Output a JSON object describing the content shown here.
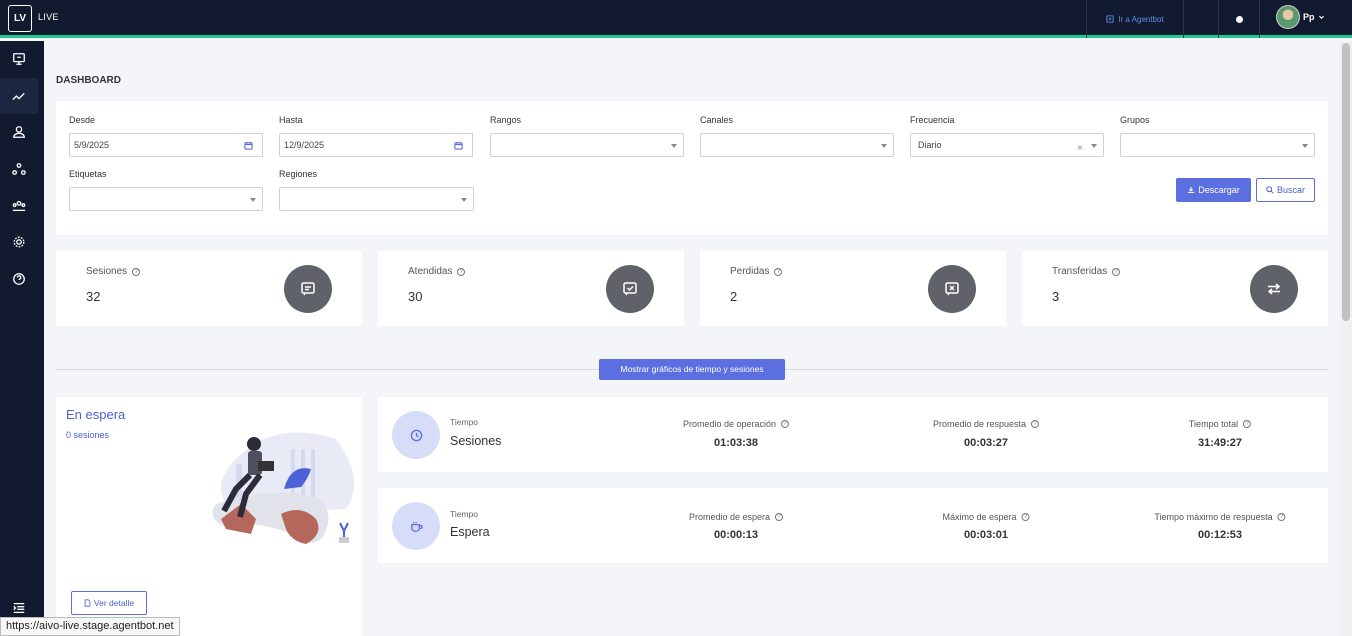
{
  "header": {
    "logo": "LV",
    "app_name": "LIVE",
    "agentbot_link": "Ir a Agentbot",
    "user_initials": "Pp"
  },
  "sidebar": {
    "items": [
      {
        "icon": "monitor-icon"
      },
      {
        "icon": "chart-line-icon",
        "active": true
      },
      {
        "icon": "user-icon"
      },
      {
        "icon": "network-icon"
      },
      {
        "icon": "team-icon"
      },
      {
        "icon": "gear-icon"
      },
      {
        "icon": "help-icon"
      }
    ]
  },
  "page": {
    "title": "DASHBOARD"
  },
  "filters": {
    "desde_label": "Desde",
    "desde_value": "5/9/2025",
    "hasta_label": "Hasta",
    "hasta_value": "12/9/2025",
    "rangos_label": "Rangos",
    "rangos_value": "",
    "canales_label": "Canales",
    "canales_value": "",
    "frecuencia_label": "Frecuencia",
    "frecuencia_value": "Diario",
    "grupos_label": "Grupos",
    "grupos_value": "",
    "etiquetas_label": "Etiquetas",
    "etiquetas_value": "",
    "regiones_label": "Regiones",
    "regiones_value": "",
    "download_label": "Descargar",
    "search_label": "Buscar"
  },
  "stats": [
    {
      "label": "Sesiones",
      "value": "32"
    },
    {
      "label": "Atendidas",
      "value": "30"
    },
    {
      "label": "Perdidas",
      "value": "2"
    },
    {
      "label": "Transferidas",
      "value": "3"
    }
  ],
  "toggle_charts": "Mostrar gráficos de tiempo y sesiones",
  "waiting": {
    "title": "En espera",
    "subtitle": "0 sesiones",
    "detail_button": "Ver detalle"
  },
  "metrics": {
    "sessions": {
      "small": "Tiempo",
      "big": "Sesiones",
      "cols": [
        {
          "label": "Promedio de operación",
          "value": "01:03:38"
        },
        {
          "label": "Promedio de respuesta",
          "value": "00:03:27"
        },
        {
          "label": "Tiempo total",
          "value": "31:49:27"
        }
      ]
    },
    "waiting": {
      "small": "Tiempo",
      "big": "Espera",
      "cols": [
        {
          "label": "Promedio de espera",
          "value": "00:00:13"
        },
        {
          "label": "Máximo de espera",
          "value": "00:03:01"
        },
        {
          "label": "Tiempo máximo de respuesta",
          "value": "00:12:53"
        }
      ]
    }
  },
  "status_url": "https://aivo-live.stage.agentbot.net",
  "colors": {
    "topbar": "#111a2e",
    "accent_line": "#1fc98e",
    "primary": "#5b6fe0",
    "stat_icon_bg": "#5f6268"
  }
}
